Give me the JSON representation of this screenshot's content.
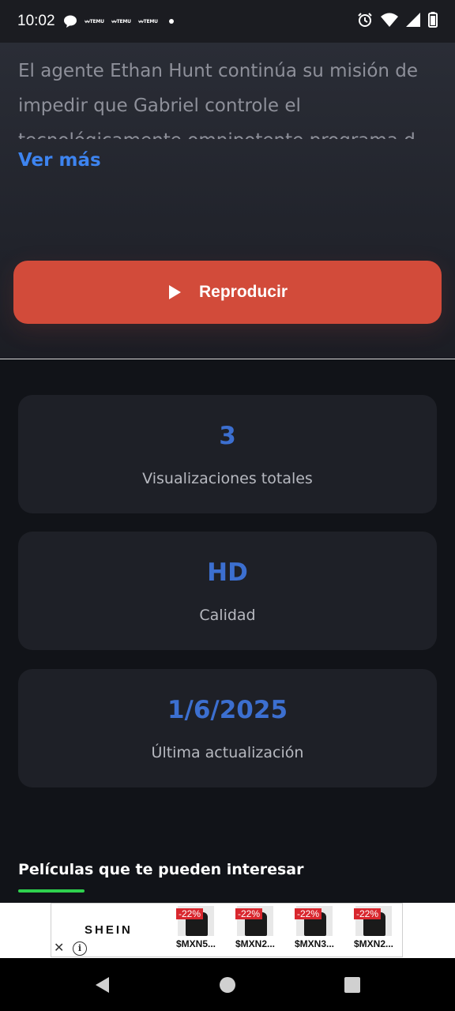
{
  "status_bar": {
    "time": "10:02",
    "temu_label": "TEMU",
    "icons": [
      "chat-bubble-icon",
      "temu-icon",
      "temu-icon",
      "temu-icon",
      "dot-icon",
      "alarm-icon",
      "wifi-icon",
      "signal-icon",
      "battery-icon"
    ]
  },
  "hero": {
    "synopsis": "El agente Ethan Hunt continúa su misión de impedir que Gabriel controle el tecnológicamente omnipotente programa d",
    "see_more": "Ver más",
    "play_button": "Reproducir"
  },
  "stats": [
    {
      "value": "3",
      "label": "Visualizaciones totales"
    },
    {
      "value": "HD",
      "label": "Calidad"
    },
    {
      "value": "1/6/2025",
      "label": "Última actualización"
    }
  ],
  "recommendations": {
    "title": "Películas que te pueden interesar"
  },
  "ad": {
    "brand": "SHEIN",
    "close": "✕",
    "info": "i",
    "products": [
      {
        "discount": "-22%",
        "price": "$MXN5..."
      },
      {
        "discount": "-22%",
        "price": "$MXN2..."
      },
      {
        "discount": "-22%",
        "price": "$MXN3..."
      },
      {
        "discount": "-22%",
        "price": "$MXN2..."
      }
    ]
  },
  "colors": {
    "accent_red": "#d24b3a",
    "accent_blue": "#3d84f0",
    "accent_green": "#2fd14e"
  }
}
